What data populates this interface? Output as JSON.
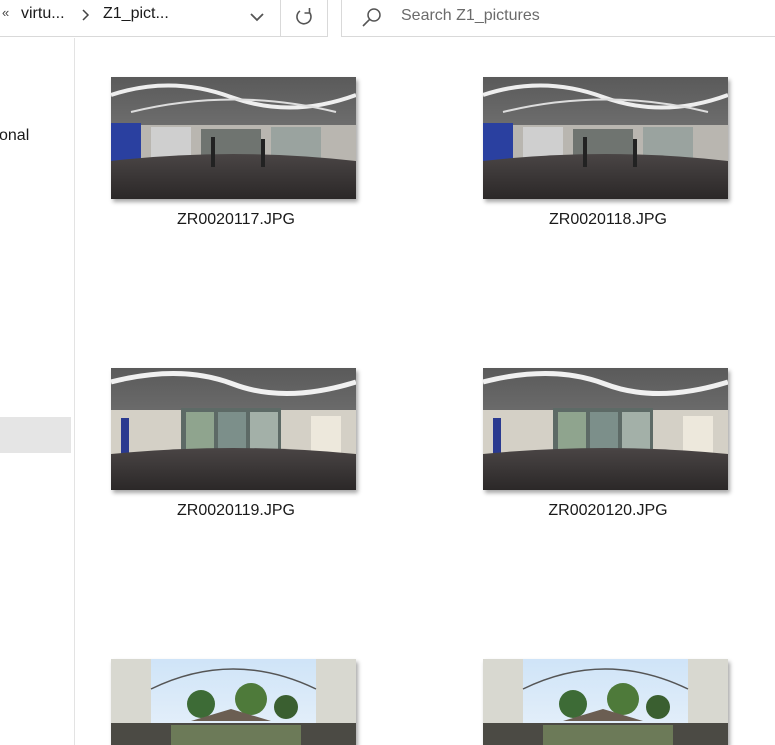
{
  "address_bar": {
    "overflow_glyph": "«",
    "crumbs": [
      "virtu...",
      "Z1_pict..."
    ]
  },
  "search": {
    "placeholder": "Search Z1_pictures"
  },
  "nav": {
    "partial_item": "onal"
  },
  "files": [
    {
      "name": "ZR0020117.JPG",
      "scene": "gym-interior"
    },
    {
      "name": "ZR0020118.JPG",
      "scene": "gym-interior"
    },
    {
      "name": "ZR0020119.JPG",
      "scene": "gym-windows"
    },
    {
      "name": "ZR0020120.JPG",
      "scene": "gym-windows"
    },
    {
      "name": "",
      "scene": "outdoor-courtyard"
    },
    {
      "name": "",
      "scene": "outdoor-courtyard"
    }
  ]
}
